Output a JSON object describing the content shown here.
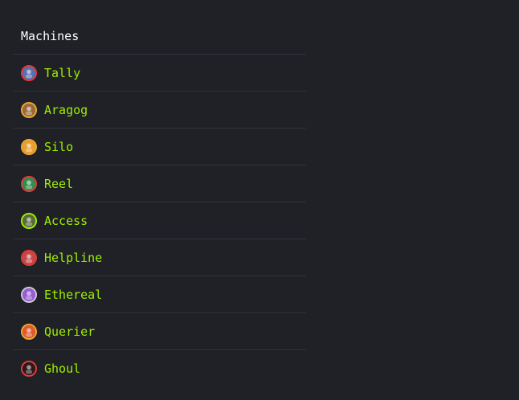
{
  "section": {
    "title": "Machines"
  },
  "machines": [
    {
      "name": "Tally",
      "avatar_icon": "tally-avatar-icon",
      "ring_color": "#e23b3b",
      "fill_color": "#5a6fb0"
    },
    {
      "name": "Aragog",
      "avatar_icon": "aragog-avatar-icon",
      "ring_color": "#f0a830",
      "fill_color": "#9a6a3c"
    },
    {
      "name": "Silo",
      "avatar_icon": "silo-avatar-icon",
      "ring_color": "#f0a830",
      "fill_color": "#e8a030"
    },
    {
      "name": "Reel",
      "avatar_icon": "reel-avatar-icon",
      "ring_color": "#e23b3b",
      "fill_color": "#2f8f4f"
    },
    {
      "name": "Access",
      "avatar_icon": "access-avatar-icon",
      "ring_color": "#9fef00",
      "fill_color": "#5b6a3a"
    },
    {
      "name": "Helpline",
      "avatar_icon": "helpline-avatar-icon",
      "ring_color": "#e23b3b",
      "fill_color": "#c44a4a"
    },
    {
      "name": "Ethereal",
      "avatar_icon": "ethereal-avatar-icon",
      "ring_color": "#c9c9d4",
      "fill_color": "#9b5bd6"
    },
    {
      "name": "Querier",
      "avatar_icon": "querier-avatar-icon",
      "ring_color": "#f0a830",
      "fill_color": "#e05a30"
    },
    {
      "name": "Ghoul",
      "avatar_icon": "ghoul-avatar-icon",
      "ring_color": "#e23b3b",
      "fill_color": "#2a1a1a"
    }
  ]
}
